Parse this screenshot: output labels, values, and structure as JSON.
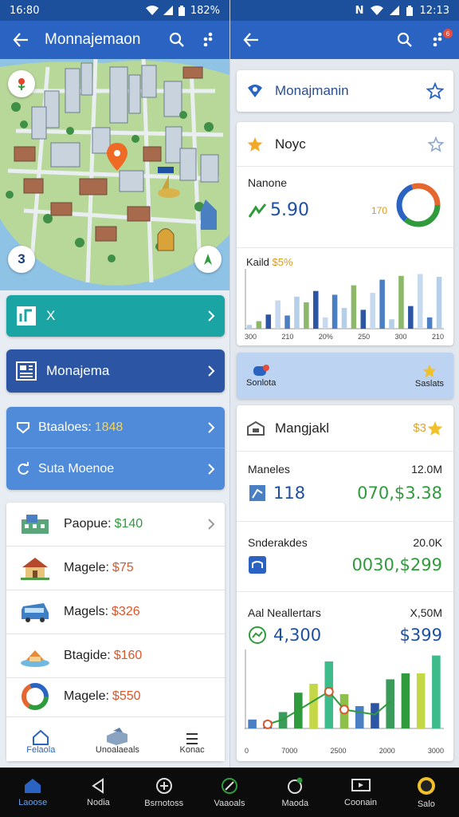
{
  "left": {
    "status": {
      "time": "16:80",
      "battery": "182%"
    },
    "appbar": {
      "title": "Monnajemaon"
    },
    "map": {
      "badge_number": "3"
    },
    "teal_bar": {
      "label": "X"
    },
    "blue_bar": {
      "label": "Monajema"
    },
    "light_bar": {
      "row1_label": "Btaaloes:",
      "row1_value": "1848",
      "row2_label": "Suta Moenoe"
    },
    "properties": [
      {
        "label": "Paopue:",
        "price": "$140",
        "color": "#2f9b3c"
      },
      {
        "label": "Magele:",
        "price": "$75",
        "color": "#d9582b"
      },
      {
        "label": "Magels:",
        "price": "$326",
        "color": "#d9582b"
      },
      {
        "label": "Btagide:",
        "price": "$160",
        "color": "#d9582b"
      },
      {
        "label": "Magele:",
        "price": "$550",
        "color": "#d9582b"
      }
    ],
    "bottom_nav": {
      "item1": "Felaola",
      "item2": "Unoalaeals",
      "item3": "Konac"
    }
  },
  "right": {
    "status": {
      "carrier": "N",
      "time": "12:13"
    },
    "appbar": {
      "badge": "6"
    },
    "search_card": {
      "label": "Monajmanin"
    },
    "summary_card": {
      "title": "Noyc",
      "metric_label": "Nanone",
      "metric_value": "5.90",
      "metric_side": "170",
      "bar_label": "Kaild",
      "bar_label_value": "$5%",
      "ticks": [
        "300",
        "210",
        "20%",
        "250",
        "300",
        "210"
      ]
    },
    "tab_strip": {
      "left_label": "Sonlota",
      "right_label": "Saslats"
    },
    "finance_card": {
      "title": "Mangjakl",
      "title_value": "$3",
      "row1": {
        "label": "Maneles",
        "side": "12.0M",
        "value": "118",
        "money": "070,$3.38"
      },
      "row2": {
        "label": "Snderakdes",
        "side": "20.0K",
        "money": "0030,$299"
      },
      "row3": {
        "label": "Aal Neallertars",
        "side": "X,50M",
        "value": "4,300",
        "money": "$399"
      },
      "ticks": [
        "0",
        "7000",
        "2500",
        "2000",
        "3000"
      ]
    }
  },
  "system_nav": [
    "Laoose",
    "Nodia",
    "Bsrnotoss",
    "Vaaoals",
    "Maoda",
    "Coonain",
    "Salo"
  ],
  "colors": {
    "primary": "#2a63c2",
    "teal": "#1aa4a4",
    "navy": "#2c56a3",
    "green": "#2f9b3c",
    "orange": "#e4672f"
  },
  "chart_data": [
    {
      "type": "bar",
      "title": "Kaild",
      "categories": [
        "300",
        "210",
        "20%",
        "250",
        "300",
        "210"
      ],
      "series": [
        {
          "values": [
            4,
            8,
            15,
            30,
            14,
            34,
            28,
            40,
            12,
            36,
            22,
            46,
            20,
            38,
            52,
            10,
            56,
            24,
            58,
            12,
            55
          ]
        }
      ]
    },
    {
      "type": "bar",
      "title": "Aal Neallertars",
      "categories": [
        "0",
        "7000",
        "2500",
        "2000",
        "3000"
      ],
      "series": [
        {
          "values": [
            12,
            10,
            22,
            48,
            60,
            90,
            46,
            30,
            34,
            66,
            74,
            74,
            98
          ]
        }
      ]
    }
  ]
}
